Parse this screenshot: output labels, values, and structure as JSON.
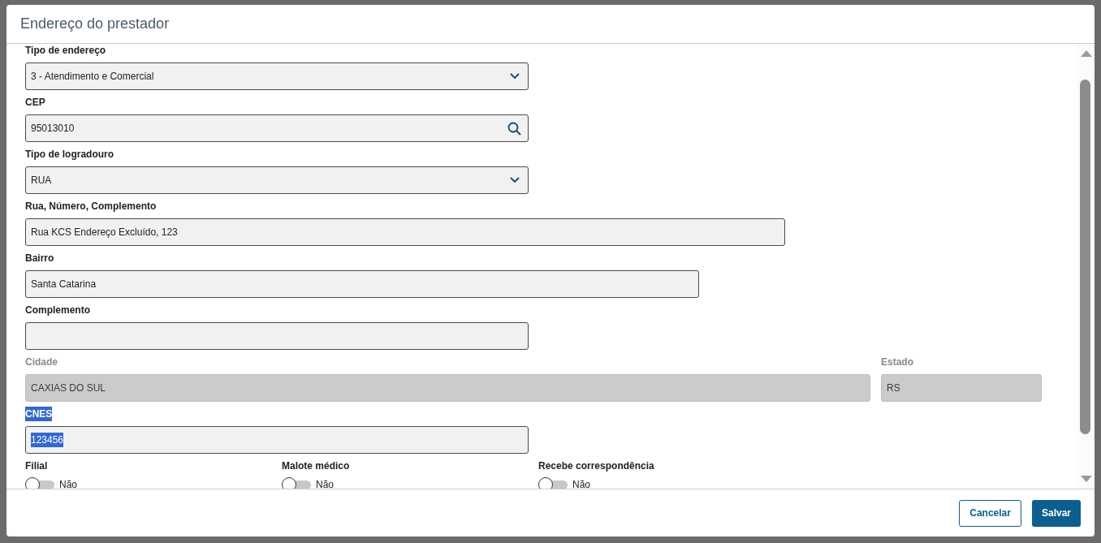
{
  "dialog": {
    "title": "Endereço do prestador"
  },
  "rows": [
    {
      "fields": [
        {
          "label": "Tipo de endereço",
          "kind": "select",
          "value": "3 - Atendimento e Comercial",
          "disabled": false,
          "highlighted": false
        }
      ]
    },
    {
      "fields": [
        {
          "label": "CEP",
          "kind": "search",
          "value": "95013010",
          "disabled": false,
          "highlighted": false
        }
      ]
    },
    {
      "fields": [
        {
          "label": "Tipo de logradouro",
          "kind": "select",
          "value": "RUA",
          "disabled": false,
          "highlighted": false
        }
      ]
    },
    {
      "fields": [
        {
          "label": "Rua, Número, Complemento",
          "kind": "text",
          "value": "Rua KCS Endereço Excluído, 123",
          "disabled": false,
          "highlighted": false
        }
      ]
    },
    {
      "fields": [
        {
          "label": "Bairro",
          "kind": "text",
          "value": "Santa Catarina",
          "disabled": false,
          "highlighted": false
        }
      ]
    },
    {
      "fields": [
        {
          "label": "Complemento",
          "kind": "text",
          "disabled": false,
          "highlighted": false
        }
      ]
    },
    {
      "fields": [
        {
          "label": "Cidade",
          "kind": "text",
          "value": "CAXIAS DO SUL",
          "disabled": true,
          "highlighted": false
        },
        {
          "label": "Estado",
          "kind": "text",
          "value": "RS",
          "disabled": true,
          "highlighted": false
        }
      ]
    },
    {
      "fields": [
        {
          "label": "CNES",
          "kind": "text",
          "value": "123456",
          "disabled": false,
          "highlighted": true
        }
      ]
    }
  ],
  "switches": [
    {
      "label": "Filial",
      "on": false,
      "state_text": "Não"
    },
    {
      "label": "Malote médico",
      "on": false,
      "state_text": "Não"
    },
    {
      "label": "Recebe correspondência",
      "on": false,
      "state_text": "Não"
    }
  ],
  "buttons": [
    {
      "label": "Cancelar",
      "kind": "secondary"
    },
    {
      "label": "Salvar",
      "kind": "primary"
    }
  ]
}
